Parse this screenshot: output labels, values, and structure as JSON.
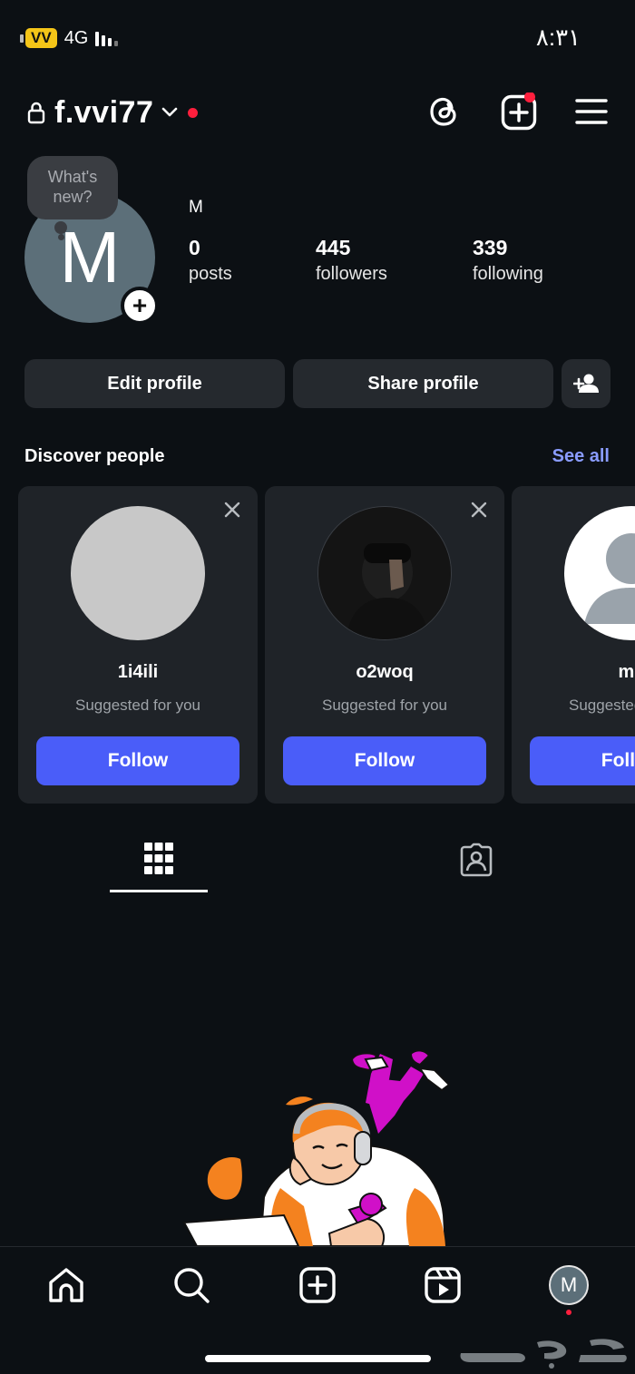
{
  "status_bar": {
    "carrier": "VV",
    "network": "4G",
    "time": "٨:٣١"
  },
  "header": {
    "username": "f.vvi77",
    "icons": [
      "lock-icon",
      "chevron-down-icon",
      "threads-icon",
      "create-post-icon",
      "menu-icon"
    ]
  },
  "profile": {
    "avatar_letter": "M",
    "note_text": "What's new?",
    "display_name": "M",
    "stats": [
      {
        "value": "0",
        "label": "posts"
      },
      {
        "value": "445",
        "label": "followers"
      },
      {
        "value": "339",
        "label": "following"
      }
    ]
  },
  "actions": {
    "edit_label": "Edit profile",
    "share_label": "Share profile"
  },
  "discover": {
    "title": "Discover people",
    "see_all": "See all",
    "cards": [
      {
        "name": "1i4ili",
        "subtitle": "Suggested for you",
        "follow_label": "Follow"
      },
      {
        "name": "o2woq",
        "subtitle": "Suggested for you",
        "follow_label": "Follow"
      },
      {
        "name": "me",
        "subtitle": "Suggested for you",
        "follow_label": "Follow"
      }
    ]
  },
  "tabs": [
    "grid-icon",
    "tagged-icon"
  ],
  "bottom_nav": {
    "avatar_letter": "M",
    "items": [
      "home-icon",
      "search-icon",
      "create-icon",
      "reels-icon",
      "profile-avatar"
    ]
  },
  "watermark": "حراج",
  "colors": {
    "background": "#0c1014",
    "accent": "#4a5df9",
    "link": "#8a9cff",
    "notification": "#ff1f3d"
  }
}
